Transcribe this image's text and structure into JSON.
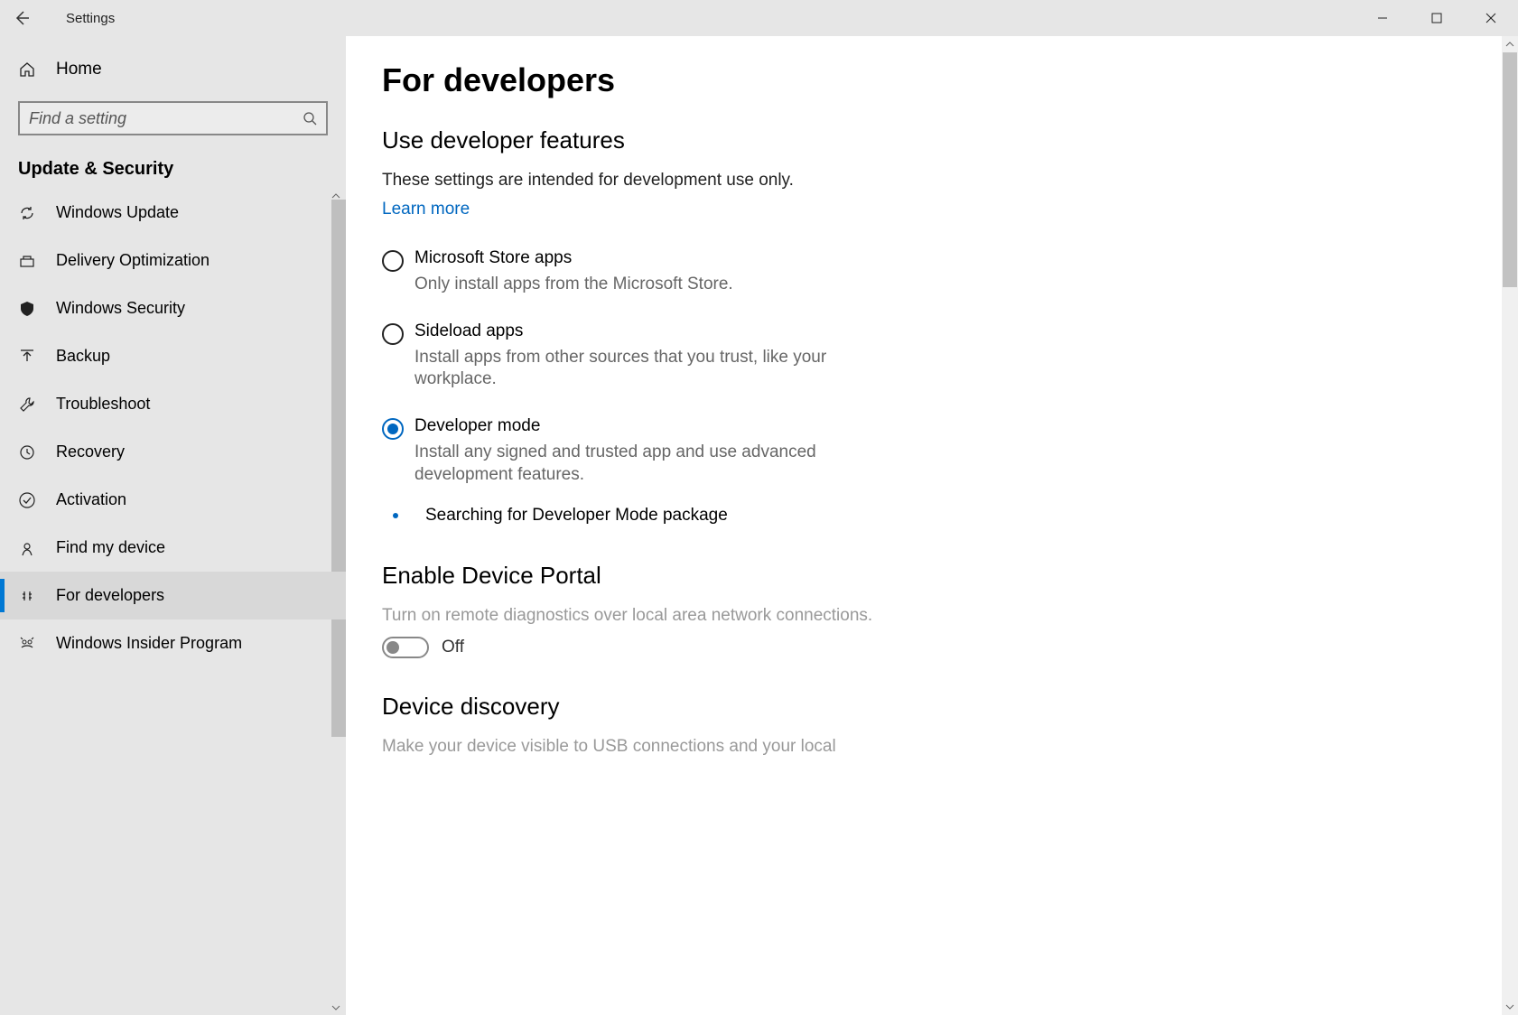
{
  "window": {
    "title": "Settings"
  },
  "sidebar": {
    "home": "Home",
    "search_placeholder": "Find a setting",
    "section": "Update & Security",
    "items": [
      {
        "label": "Windows Update",
        "icon": "sync-icon"
      },
      {
        "label": "Delivery Optimization",
        "icon": "delivery-icon"
      },
      {
        "label": "Windows Security",
        "icon": "shield-icon"
      },
      {
        "label": "Backup",
        "icon": "backup-icon"
      },
      {
        "label": "Troubleshoot",
        "icon": "wrench-icon"
      },
      {
        "label": "Recovery",
        "icon": "recovery-icon"
      },
      {
        "label": "Activation",
        "icon": "check-circle-icon"
      },
      {
        "label": "Find my device",
        "icon": "location-icon"
      },
      {
        "label": "For developers",
        "icon": "developer-icon",
        "selected": true
      },
      {
        "label": "Windows Insider Program",
        "icon": "insider-icon"
      }
    ]
  },
  "main": {
    "title": "For developers",
    "dev_features": {
      "heading": "Use developer features",
      "desc": "These settings are intended for development use only.",
      "learn_more": "Learn more",
      "options": [
        {
          "label": "Microsoft Store apps",
          "desc": "Only install apps from the Microsoft Store.",
          "checked": false
        },
        {
          "label": "Sideload apps",
          "desc": "Install apps from other sources that you trust, like your workplace.",
          "checked": false
        },
        {
          "label": "Developer mode",
          "desc": "Install any signed and trusted app and use advanced development features.",
          "checked": true
        }
      ],
      "status": "Searching for Developer Mode package"
    },
    "device_portal": {
      "heading": "Enable Device Portal",
      "desc": "Turn on remote diagnostics over local area network connections.",
      "toggle_state": "Off"
    },
    "device_discovery": {
      "heading": "Device discovery",
      "desc": "Make your device visible to USB connections and your local"
    }
  }
}
